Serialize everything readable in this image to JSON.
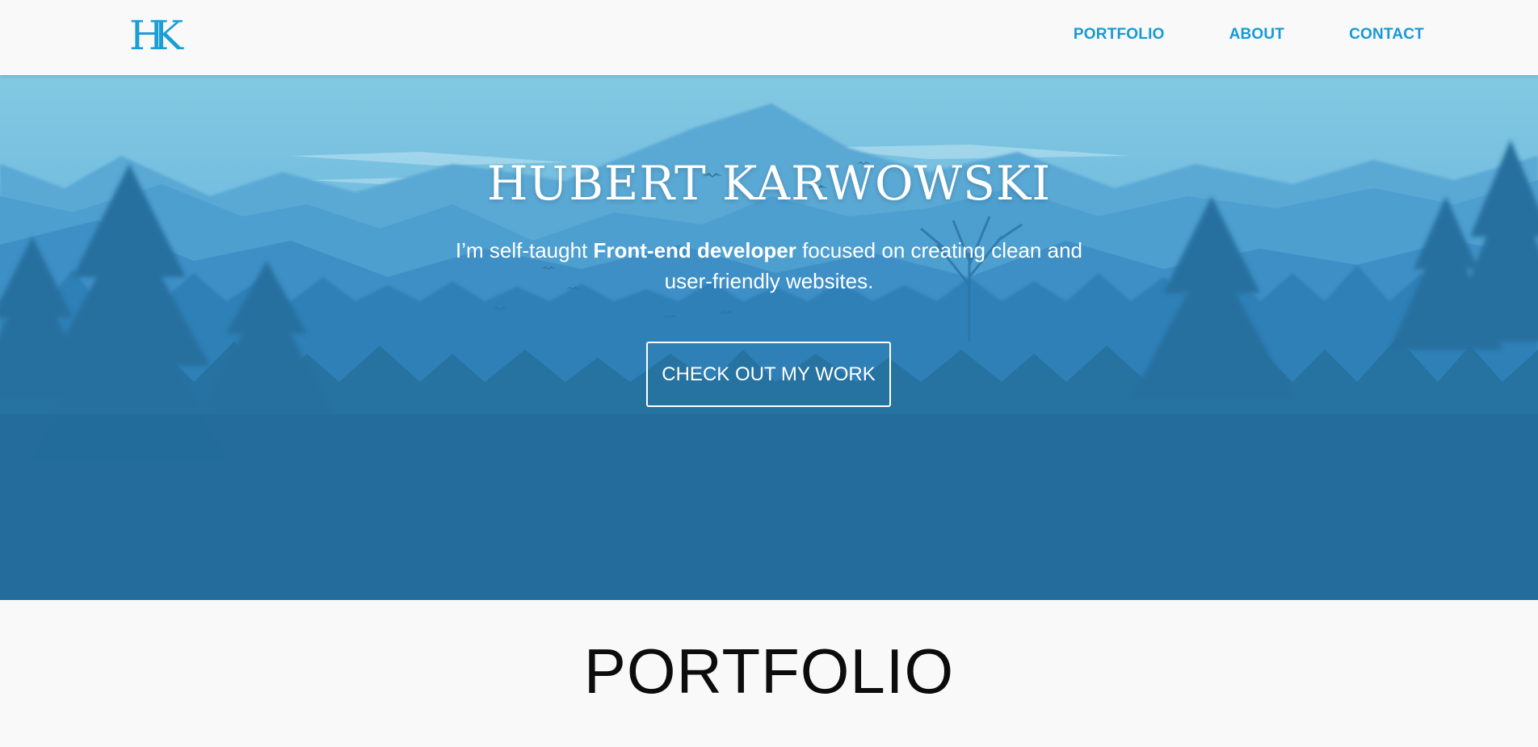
{
  "nav": {
    "logo": "HK",
    "links": [
      "PORTFOLIO",
      "ABOUT",
      "CONTACT"
    ]
  },
  "hero": {
    "title": "HUBERT KARWOWSKI",
    "subtitle_pre": "I’m self-taught ",
    "subtitle_bold": "Front-end developer",
    "subtitle_post": " focused on creating clean and user-friendly websites.",
    "cta_label": "CHECK OUT MY WORK"
  },
  "portfolio": {
    "title": "PORTFOLIO"
  },
  "colors": {
    "accent": "#159ad6",
    "hero_top": "#81c7e0",
    "hero_bottom": "#1f6d9f",
    "page_bg": "#f9f9f9"
  }
}
